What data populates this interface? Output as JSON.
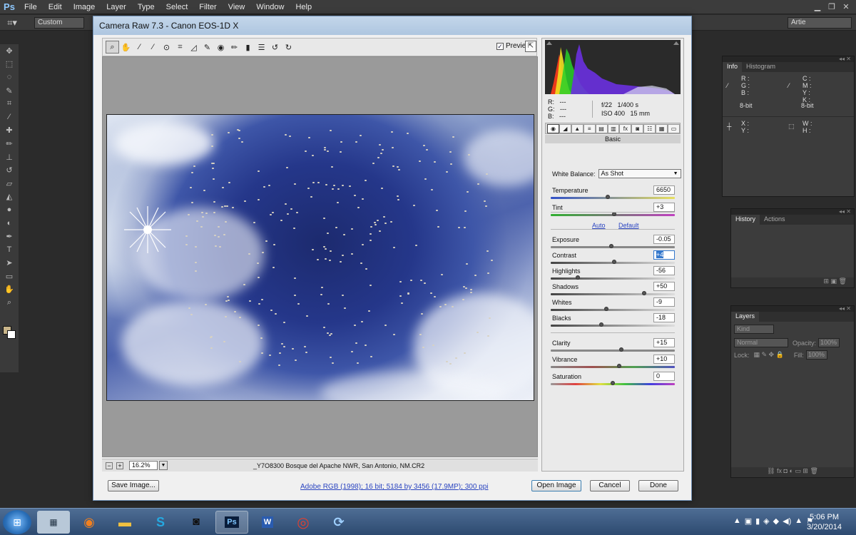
{
  "app": {
    "logo": "Ps",
    "menu": [
      "File",
      "Edit",
      "Image",
      "Layer",
      "Type",
      "Select",
      "Filter",
      "View",
      "Window",
      "Help"
    ],
    "options_preset": "Custom",
    "workspace": "Artie"
  },
  "panels": {
    "info": {
      "tabs": [
        "Info",
        "Histogram"
      ],
      "left_labels": "R :\nG :\nB :",
      "right_labels": "C :\nM :\nY :\nK :",
      "bit_left": "8-bit",
      "bit_right": "8-bit",
      "xy_labels": "X :\nY :",
      "wh_labels": "W :\nH :"
    },
    "history": {
      "tabs": [
        "History",
        "Actions"
      ]
    },
    "layers": {
      "title": "Layers",
      "kind": "Kind",
      "blend": "Normal",
      "opacity_label": "Opacity:",
      "opacity_value": "100%",
      "lock_label": "Lock:",
      "fill_label": "Fill:",
      "fill_value": "100%"
    }
  },
  "dialog": {
    "title": "Camera Raw 7.3  -  Canon EOS-1D X",
    "preview_label": "Preview",
    "zoom": "16.2%",
    "filename": "_Y7O8300 Bosque del Apache NWR, San Antonio, NM.CR2",
    "workflow": "Adobe RGB (1998); 16 bit; 5184 by 3456 (17.9MP); 300 ppi",
    "buttons": {
      "save": "Save Image...",
      "open": "Open Image",
      "cancel": "Cancel",
      "done": "Done"
    },
    "camera_info": {
      "rgb": "R:   ---\nG:   ---\nB:   ---",
      "aperture": "f/22",
      "shutter": "1/400 s",
      "iso": "ISO 400",
      "focal": "15 mm"
    },
    "basic_title": "Basic",
    "white_balance_label": "White Balance:",
    "white_balance_value": "As Shot",
    "auto_link": "Auto",
    "default_link": "Default",
    "sliders": [
      {
        "label": "Temperature",
        "value": "6650",
        "pos": 0.46
      },
      {
        "label": "Tint",
        "value": "+3",
        "pos": 0.51
      },
      {
        "label": "Exposure",
        "value": "-0.05",
        "pos": 0.49
      },
      {
        "label": "Contrast",
        "value": "+4",
        "pos": 0.51
      },
      {
        "label": "Highlights",
        "value": "-56",
        "pos": 0.22
      },
      {
        "label": "Shadows",
        "value": "+50",
        "pos": 0.75
      },
      {
        "label": "Whites",
        "value": "-9",
        "pos": 0.45
      },
      {
        "label": "Blacks",
        "value": "-18",
        "pos": 0.41
      },
      {
        "label": "Clarity",
        "value": "+15",
        "pos": 0.57
      },
      {
        "label": "Vibrance",
        "value": "+10",
        "pos": 0.55
      },
      {
        "label": "Saturation",
        "value": "0",
        "pos": 0.5
      }
    ]
  },
  "taskbar": {
    "start_label": "⊞",
    "clock_time": "5:06 PM",
    "clock_date": "3/20/2014"
  }
}
